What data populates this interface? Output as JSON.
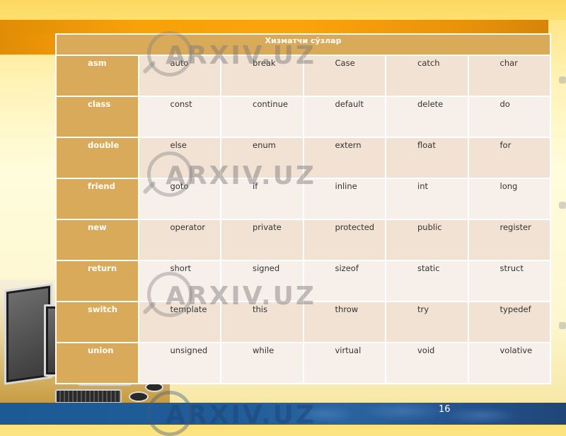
{
  "slide": {
    "page_number": "16",
    "watermark": "ARXIV.UZ"
  },
  "table": {
    "title": "Хизматчи сўзлар",
    "rows": [
      {
        "key": "asm",
        "values": [
          "auto",
          "break",
          "Case",
          "catch",
          "char"
        ]
      },
      {
        "key": "class",
        "values": [
          "const",
          "continue",
          "default",
          "delete",
          "do"
        ]
      },
      {
        "key": "double",
        "values": [
          "else",
          "enum",
          "extern",
          "float",
          "for"
        ]
      },
      {
        "key": "friend",
        "values": [
          "goto",
          "if",
          "inline",
          "int",
          "long"
        ]
      },
      {
        "key": "new",
        "values": [
          "operator",
          "private",
          "protected",
          "public",
          "register"
        ]
      },
      {
        "key": "return",
        "values": [
          "short",
          "signed",
          "sizeof",
          "static",
          "struct"
        ]
      },
      {
        "key": "switch",
        "values": [
          "template",
          "this",
          "throw",
          "try",
          "typedef"
        ]
      },
      {
        "key": "union",
        "values": [
          "unsigned",
          "while",
          "virtual",
          "void",
          "volative"
        ]
      }
    ]
  },
  "colors": {
    "header_bg": "#d9aa5a",
    "row_odd_bg": "#f1e2d3",
    "row_even_bg": "#f7efe9",
    "orange_bar": "#f7a20a",
    "footer_blue": "#205d98"
  }
}
